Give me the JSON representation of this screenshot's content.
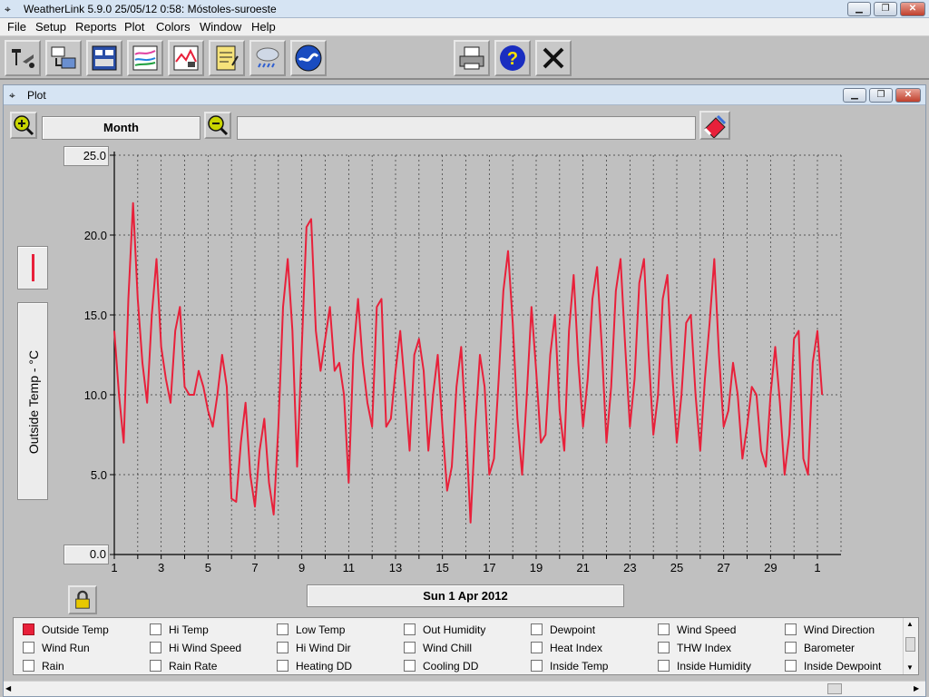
{
  "app": {
    "title": "WeatherLink 5.9.0  25/05/12  0:58: Móstoles-suroeste"
  },
  "menu": [
    "File",
    "Setup",
    "Reports",
    "Plot",
    "Colors",
    "Window",
    "Help"
  ],
  "toolbar": {
    "buttons": [
      {
        "icon": "station-icon"
      },
      {
        "icon": "download-icon"
      },
      {
        "icon": "bulletin-icon"
      },
      {
        "icon": "summary-icon"
      },
      {
        "icon": "plot-icon"
      },
      {
        "icon": "notes-icon"
      },
      {
        "icon": "weather-icon"
      },
      {
        "icon": "noaa-icon"
      },
      {
        "icon": "print-icon"
      },
      {
        "icon": "help-icon"
      },
      {
        "icon": "close-icon"
      }
    ]
  },
  "plot_window": {
    "title": "Plot",
    "period": "Month",
    "date_label": "Sun 1 Apr 2012",
    "y_axis_label": "Outside Temp - °C",
    "y_max_label": "25.0",
    "y_min_label": "0.0"
  },
  "colors": {
    "series": "#e8203a",
    "background": "#c0c0c0"
  },
  "chart_data": {
    "type": "line",
    "ylabel": "Outside Temp - °C",
    "xlabel": "",
    "ylim": [
      0,
      25
    ],
    "yticks": [
      "0.0",
      "5.0",
      "10.0",
      "15.0",
      "20.0",
      "25.0"
    ],
    "xticks": [
      "1",
      "3",
      "5",
      "7",
      "9",
      "11",
      "13",
      "15",
      "17",
      "19",
      "21",
      "23",
      "25",
      "27",
      "29",
      "1"
    ],
    "grid": true,
    "series": [
      {
        "name": "Outside Temp",
        "x_days": [
          1.0,
          1.2,
          1.4,
          1.6,
          1.8,
          2.0,
          2.2,
          2.4,
          2.6,
          2.8,
          3.0,
          3.2,
          3.4,
          3.6,
          3.8,
          4.0,
          4.2,
          4.4,
          4.6,
          4.8,
          5.0,
          5.2,
          5.4,
          5.6,
          5.8,
          6.0,
          6.2,
          6.4,
          6.6,
          6.8,
          7.0,
          7.2,
          7.4,
          7.6,
          7.8,
          8.0,
          8.2,
          8.4,
          8.6,
          8.8,
          9.0,
          9.2,
          9.4,
          9.6,
          9.8,
          10.0,
          10.2,
          10.4,
          10.6,
          10.8,
          11.0,
          11.2,
          11.4,
          11.6,
          11.8,
          12.0,
          12.2,
          12.4,
          12.6,
          12.8,
          13.0,
          13.2,
          13.4,
          13.6,
          13.8,
          14.0,
          14.2,
          14.4,
          14.6,
          14.8,
          15.0,
          15.2,
          15.4,
          15.6,
          15.8,
          16.0,
          16.2,
          16.4,
          16.6,
          16.8,
          17.0,
          17.2,
          17.4,
          17.6,
          17.8,
          18.0,
          18.2,
          18.4,
          18.6,
          18.8,
          19.0,
          19.2,
          19.4,
          19.6,
          19.8,
          20.0,
          20.2,
          20.4,
          20.6,
          20.8,
          21.0,
          21.2,
          21.4,
          21.6,
          21.8,
          22.0,
          22.2,
          22.4,
          22.6,
          22.8,
          23.0,
          23.2,
          23.4,
          23.6,
          23.8,
          24.0,
          24.2,
          24.4,
          24.6,
          24.8,
          25.0,
          25.2,
          25.4,
          25.6,
          25.8,
          26.0,
          26.2,
          26.4,
          26.6,
          26.8,
          27.0,
          27.2,
          27.4,
          27.6,
          27.8,
          28.0,
          28.2,
          28.4,
          28.6,
          28.8,
          29.0,
          29.2,
          29.4,
          29.6,
          29.8,
          30.0,
          30.2,
          30.4,
          30.6,
          30.8,
          31.0,
          31.2
        ],
        "values": [
          14.0,
          10.0,
          7.0,
          16.0,
          22.0,
          16.0,
          12.0,
          9.5,
          15.0,
          18.5,
          13.0,
          11.0,
          9.5,
          14.0,
          15.5,
          10.5,
          10.0,
          10.0,
          11.5,
          10.5,
          9.0,
          8.0,
          10.0,
          12.5,
          10.5,
          3.5,
          3.3,
          7.0,
          9.5,
          5.0,
          3.0,
          6.5,
          8.5,
          4.5,
          2.5,
          8.0,
          15.5,
          18.5,
          14.0,
          5.5,
          13.0,
          20.5,
          21.0,
          14.0,
          11.5,
          13.5,
          15.5,
          11.5,
          12.0,
          10.0,
          4.5,
          12.5,
          16.0,
          12.0,
          9.5,
          8.0,
          15.5,
          16.0,
          8.0,
          8.5,
          11.5,
          14.0,
          10.5,
          6.5,
          12.5,
          13.5,
          11.5,
          6.5,
          10.0,
          12.5,
          8.0,
          4.0,
          5.5,
          10.5,
          13.0,
          8.0,
          2.0,
          8.0,
          12.5,
          10.5,
          5.0,
          6.0,
          11.0,
          16.5,
          19.0,
          14.5,
          8.5,
          5.0,
          10.0,
          15.5,
          11.5,
          7.0,
          7.5,
          12.5,
          15.0,
          9.0,
          6.5,
          14.0,
          17.5,
          12.0,
          8.0,
          11.0,
          16.0,
          18.0,
          13.0,
          7.0,
          10.5,
          16.5,
          18.5,
          13.0,
          8.0,
          11.0,
          17.0,
          18.5,
          12.5,
          7.5,
          10.0,
          16.0,
          17.5,
          11.5,
          7.0,
          10.0,
          14.5,
          15.0,
          10.0,
          6.5,
          11.0,
          14.5,
          18.5,
          12.5,
          8.0,
          9.0,
          12.0,
          10.0,
          6.0,
          8.0,
          10.5,
          10.0,
          6.5,
          5.5,
          10.0,
          13.0,
          9.5,
          5.0,
          7.5,
          13.5,
          14.0,
          6.0,
          5.0,
          12.0,
          14.0,
          10.0,
          10.5
        ]
      }
    ]
  },
  "legend": {
    "items": [
      {
        "label": "Outside Temp",
        "checked": true
      },
      {
        "label": "Hi Temp",
        "checked": false
      },
      {
        "label": "Low Temp",
        "checked": false
      },
      {
        "label": "Out Humidity",
        "checked": false
      },
      {
        "label": "Dewpoint",
        "checked": false
      },
      {
        "label": "Wind Speed",
        "checked": false
      },
      {
        "label": "Wind Direction",
        "checked": false
      },
      {
        "label": "Wind Run",
        "checked": false
      },
      {
        "label": "Hi Wind Speed",
        "checked": false
      },
      {
        "label": "Hi Wind Dir",
        "checked": false
      },
      {
        "label": "Wind Chill",
        "checked": false
      },
      {
        "label": "Heat Index",
        "checked": false
      },
      {
        "label": "THW Index",
        "checked": false
      },
      {
        "label": "Barometer",
        "checked": false
      },
      {
        "label": "Rain",
        "checked": false
      },
      {
        "label": "Rain Rate",
        "checked": false
      },
      {
        "label": "Heating DD",
        "checked": false
      },
      {
        "label": "Cooling DD",
        "checked": false
      },
      {
        "label": "Inside Temp",
        "checked": false
      },
      {
        "label": "Inside Humidity",
        "checked": false
      },
      {
        "label": "Inside Dewpoint",
        "checked": false
      }
    ]
  }
}
